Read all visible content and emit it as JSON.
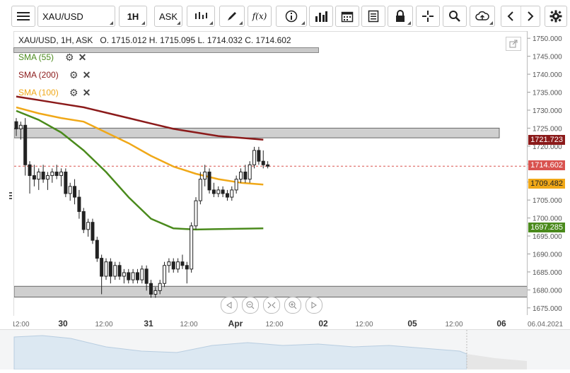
{
  "toolbar": {
    "symbol": "XAU/USD",
    "timeframe": "1H",
    "price_type": "ASK",
    "function_label": "f(x)"
  },
  "header": {
    "ohlc": "XAU/USD, 1H, ASK   O. 1715.012 H. 1715.095 L. 1714.032 C. 1714.602"
  },
  "indicators": [
    {
      "label": "SMA (55)",
      "color": "#4a8a1c"
    },
    {
      "label": "SMA (200)",
      "color": "#8b1a1a"
    },
    {
      "label": "SMA (100)",
      "color": "#f0a818"
    }
  ],
  "price_axis": {
    "ticks": [
      "1750.000",
      "1745.000",
      "1740.000",
      "1735.000",
      "1730.000",
      "1725.000",
      "1720.000",
      "1715.000",
      "1710.000",
      "1705.000",
      "1700.000",
      "1695.000",
      "1690.000",
      "1685.000",
      "1680.000",
      "1675.000"
    ],
    "badges": [
      {
        "label": "1721.723",
        "value": 1721.723,
        "color": "#8b1a1a"
      },
      {
        "label": "1714.602",
        "value": 1714.602,
        "color": "#d9534f"
      },
      {
        "label": "1709.482",
        "value": 1709.482,
        "color": "#f0a818",
        "text_color": "#222"
      },
      {
        "label": "1697.285",
        "value": 1697.285,
        "color": "#4a8a1c"
      }
    ]
  },
  "time_axis": {
    "labels": [
      "12:00",
      "30",
      "12:00",
      "31",
      "12:00",
      "Apr",
      "12:00",
      "02",
      "12:00",
      "05",
      "12:00",
      "06"
    ],
    "date": "06.04.2021"
  },
  "chart_data": {
    "type": "candlestick",
    "symbol": "XAU/USD",
    "interval": "1H",
    "ylim": [
      1673,
      1752
    ],
    "last_price": 1714.602,
    "candles": [
      {
        "o": 1727,
        "h": 1728,
        "l": 1723,
        "c": 1725
      },
      {
        "o": 1725,
        "h": 1727,
        "l": 1722,
        "c": 1726
      },
      {
        "o": 1726,
        "h": 1728,
        "l": 1712,
        "c": 1715
      },
      {
        "o": 1715,
        "h": 1716,
        "l": 1707,
        "c": 1712
      },
      {
        "o": 1712,
        "h": 1715,
        "l": 1709,
        "c": 1711
      },
      {
        "o": 1711,
        "h": 1714,
        "l": 1708,
        "c": 1713
      },
      {
        "o": 1713,
        "h": 1715,
        "l": 1710,
        "c": 1711
      },
      {
        "o": 1711,
        "h": 1713,
        "l": 1708,
        "c": 1712
      },
      {
        "o": 1712,
        "h": 1714,
        "l": 1710,
        "c": 1713
      },
      {
        "o": 1713,
        "h": 1715,
        "l": 1711,
        "c": 1712
      },
      {
        "o": 1712,
        "h": 1714,
        "l": 1709,
        "c": 1713
      },
      {
        "o": 1713,
        "h": 1714,
        "l": 1706,
        "c": 1707
      },
      {
        "o": 1707,
        "h": 1710,
        "l": 1705,
        "c": 1709
      },
      {
        "o": 1709,
        "h": 1711,
        "l": 1704,
        "c": 1706
      },
      {
        "o": 1706,
        "h": 1708,
        "l": 1700,
        "c": 1702
      },
      {
        "o": 1702,
        "h": 1703,
        "l": 1696,
        "c": 1697
      },
      {
        "o": 1697,
        "h": 1700,
        "l": 1695,
        "c": 1699
      },
      {
        "o": 1699,
        "h": 1700,
        "l": 1693,
        "c": 1694
      },
      {
        "o": 1694,
        "h": 1695,
        "l": 1688,
        "c": 1689
      },
      {
        "o": 1689,
        "h": 1690,
        "l": 1679,
        "c": 1684
      },
      {
        "o": 1684,
        "h": 1689,
        "l": 1683,
        "c": 1688
      },
      {
        "o": 1688,
        "h": 1689,
        "l": 1682,
        "c": 1684
      },
      {
        "o": 1684,
        "h": 1688,
        "l": 1683,
        "c": 1687
      },
      {
        "o": 1687,
        "h": 1688,
        "l": 1683,
        "c": 1684
      },
      {
        "o": 1684,
        "h": 1686,
        "l": 1682,
        "c": 1685
      },
      {
        "o": 1685,
        "h": 1686,
        "l": 1682,
        "c": 1683
      },
      {
        "o": 1683,
        "h": 1686,
        "l": 1682,
        "c": 1685
      },
      {
        "o": 1685,
        "h": 1686,
        "l": 1682,
        "c": 1683
      },
      {
        "o": 1683,
        "h": 1687,
        "l": 1682,
        "c": 1686
      },
      {
        "o": 1686,
        "h": 1687,
        "l": 1680,
        "c": 1682
      },
      {
        "o": 1682,
        "h": 1683,
        "l": 1678,
        "c": 1679
      },
      {
        "o": 1679,
        "h": 1681,
        "l": 1678,
        "c": 1680
      },
      {
        "o": 1680,
        "h": 1683,
        "l": 1679,
        "c": 1682
      },
      {
        "o": 1682,
        "h": 1688,
        "l": 1681,
        "c": 1687
      },
      {
        "o": 1687,
        "h": 1689,
        "l": 1685,
        "c": 1688
      },
      {
        "o": 1688,
        "h": 1689,
        "l": 1685,
        "c": 1686
      },
      {
        "o": 1686,
        "h": 1689,
        "l": 1685,
        "c": 1688
      },
      {
        "o": 1688,
        "h": 1690,
        "l": 1686,
        "c": 1687
      },
      {
        "o": 1687,
        "h": 1688,
        "l": 1682,
        "c": 1686
      },
      {
        "o": 1686,
        "h": 1699,
        "l": 1685,
        "c": 1698
      },
      {
        "o": 1698,
        "h": 1706,
        "l": 1697,
        "c": 1705
      },
      {
        "o": 1705,
        "h": 1713,
        "l": 1704,
        "c": 1711
      },
      {
        "o": 1711,
        "h": 1715,
        "l": 1709,
        "c": 1713
      },
      {
        "o": 1713,
        "h": 1714,
        "l": 1707,
        "c": 1708
      },
      {
        "o": 1708,
        "h": 1710,
        "l": 1706,
        "c": 1707
      },
      {
        "o": 1707,
        "h": 1709,
        "l": 1706,
        "c": 1708
      },
      {
        "o": 1708,
        "h": 1709,
        "l": 1706,
        "c": 1707
      },
      {
        "o": 1707,
        "h": 1708,
        "l": 1705,
        "c": 1706
      },
      {
        "o": 1706,
        "h": 1709,
        "l": 1705,
        "c": 1708
      },
      {
        "o": 1708,
        "h": 1712,
        "l": 1707,
        "c": 1711
      },
      {
        "o": 1711,
        "h": 1714,
        "l": 1710,
        "c": 1713
      },
      {
        "o": 1713,
        "h": 1715,
        "l": 1710,
        "c": 1711
      },
      {
        "o": 1711,
        "h": 1716,
        "l": 1710,
        "c": 1715
      },
      {
        "o": 1715,
        "h": 1720,
        "l": 1714,
        "c": 1719
      },
      {
        "o": 1719,
        "h": 1720,
        "l": 1715,
        "c": 1716
      },
      {
        "o": 1716,
        "h": 1719,
        "l": 1714,
        "c": 1715
      },
      {
        "o": 1715,
        "h": 1716,
        "l": 1714,
        "c": 1714.602
      }
    ],
    "sma55": [
      [
        0,
        1730
      ],
      [
        5,
        1727.5
      ],
      [
        10,
        1724
      ],
      [
        15,
        1719
      ],
      [
        20,
        1713
      ],
      [
        25,
        1706
      ],
      [
        30,
        1700
      ],
      [
        35,
        1697.3
      ],
      [
        40,
        1697
      ],
      [
        44,
        1697.1
      ],
      [
        49,
        1697.2
      ],
      [
        55,
        1697.3
      ]
    ],
    "sma100": [
      [
        0,
        1731
      ],
      [
        5,
        1729.3
      ],
      [
        10,
        1728
      ],
      [
        15,
        1727
      ],
      [
        20,
        1724
      ],
      [
        25,
        1721
      ],
      [
        30,
        1717.5
      ],
      [
        35,
        1714.5
      ],
      [
        40,
        1712.5
      ],
      [
        45,
        1711
      ],
      [
        50,
        1710
      ],
      [
        55,
        1709.5
      ]
    ],
    "sma200": [
      [
        0,
        1734
      ],
      [
        5,
        1733
      ],
      [
        10,
        1732
      ],
      [
        15,
        1731
      ],
      [
        20,
        1729.5
      ],
      [
        25,
        1728
      ],
      [
        30,
        1726.5
      ],
      [
        35,
        1725
      ],
      [
        40,
        1724
      ],
      [
        45,
        1723
      ],
      [
        50,
        1722.5
      ],
      [
        55,
        1722
      ]
    ],
    "zones": [
      [
        1722.5,
        1725.2
      ],
      [
        1678.2,
        1681.2
      ]
    ]
  }
}
